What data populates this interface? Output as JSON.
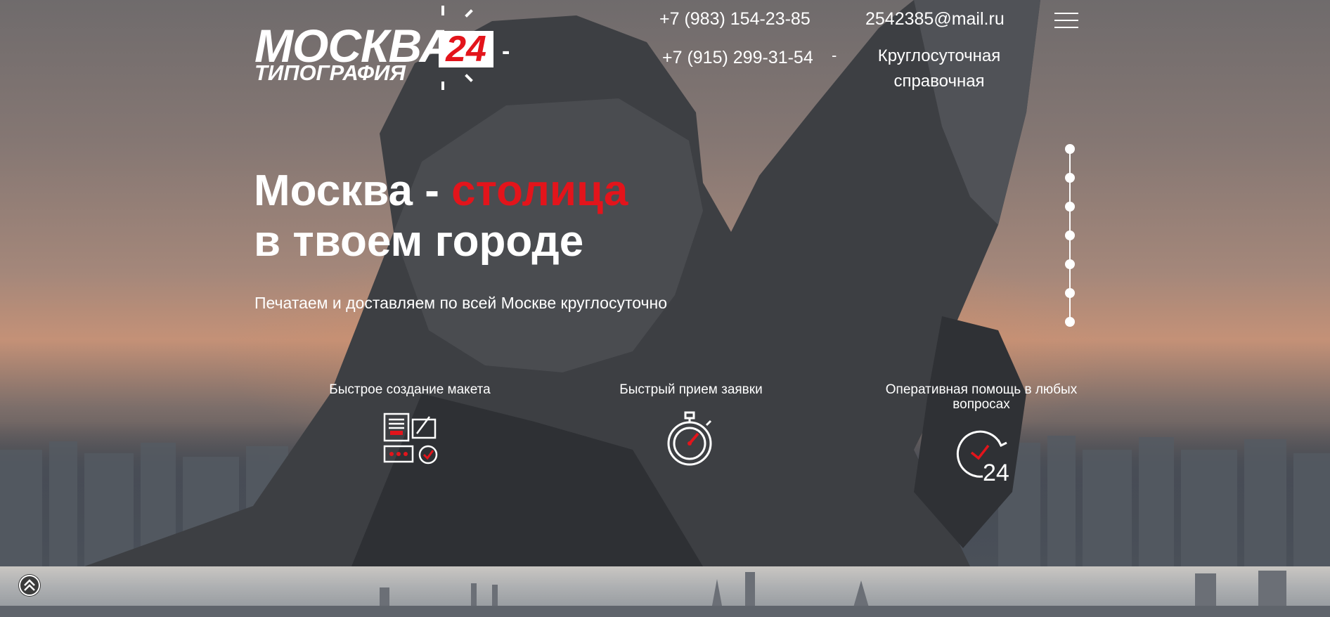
{
  "header": {
    "logo": {
      "brand": "МОСКВА",
      "number": "24",
      "subtitle": "ТИПОГРАФИЯ",
      "dash": "-"
    },
    "phones": [
      "+7 (983) 154-23-85",
      "+7 (915) 299-31-54"
    ],
    "separator": "-",
    "email": "2542385@mail.ru",
    "support": {
      "line1": "Круглосуточная",
      "line2": "справочная"
    },
    "menu_icon": "hamburger-menu-icon"
  },
  "hero": {
    "title_part1": "Москва - ",
    "title_accent": "столица",
    "title_line2": "в твоем городе",
    "subtitle": "Печатаем и доставляем по всей Москве круглосуточно"
  },
  "slider": {
    "dot_count": 7,
    "active_index": 0
  },
  "features": [
    {
      "label": "Быстрое создание макета",
      "icon": "documents-pencil-icon"
    },
    {
      "label": "Быстрый прием заявки",
      "icon": "stopwatch-icon"
    },
    {
      "label": "Оперативная помощь в любых вопросах",
      "icon": "clock-24-icon"
    }
  ],
  "scroll_up": {
    "icon": "double-chevron-up-icon"
  },
  "colors": {
    "accent": "#e3141b",
    "text": "#ffffff"
  }
}
